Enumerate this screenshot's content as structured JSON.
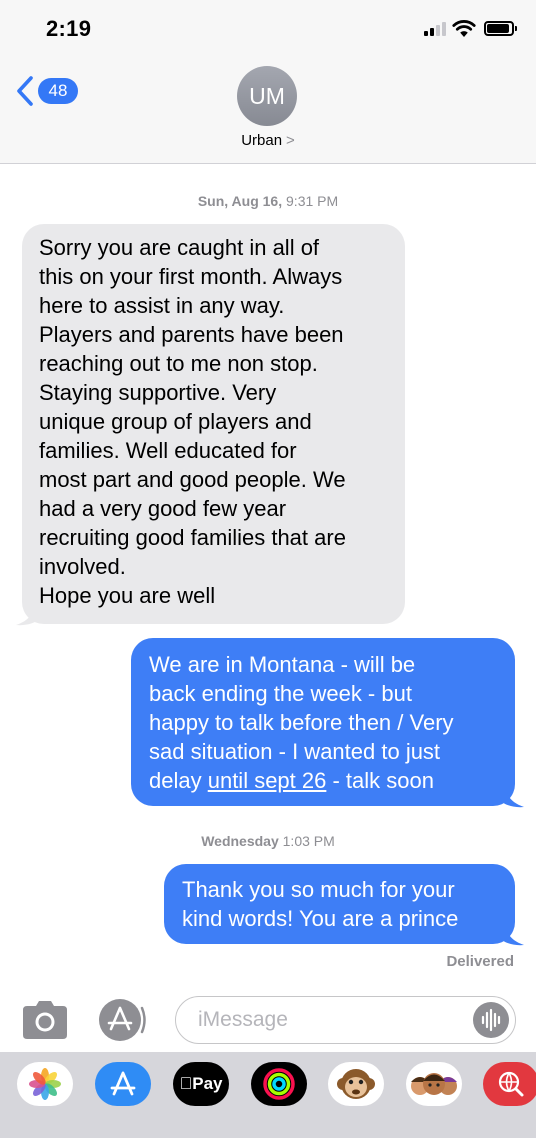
{
  "status_bar": {
    "time": "2:19",
    "signal_bars_active": 2,
    "signal_bars_total": 4,
    "battery_level": 0.9
  },
  "header": {
    "back_count": "48",
    "avatar_initials": "UM",
    "contact_name": "Urban",
    "contact_chevron": ">"
  },
  "thread": {
    "groups": [
      {
        "timestamp_day": "Sun, Aug 16,",
        "timestamp_time": "9:31 PM",
        "messages": [
          {
            "direction": "incoming",
            "lines": [
              "Sorry you are caught in all of",
              "this on your first month. Always",
              "here to assist in any way.",
              "Players and parents have been",
              "reaching out to me non stop.",
              "Staying supportive. Very",
              "unique group of players and",
              "families. Well educated for",
              "most part and good people. We",
              "had a very good few year",
              "recruiting good families that are",
              "involved.",
              "Hope you are well"
            ]
          },
          {
            "direction": "outgoing",
            "lines": [
              "We are in Montana - will be",
              "back ending the week - but",
              "happy to talk before then / Very",
              "sad situation - I wanted to just"
            ],
            "last_line_before": "delay ",
            "last_line_link": "until sept 26",
            "last_line_after": " - talk soon"
          }
        ]
      },
      {
        "timestamp_day": "Wednesday",
        "timestamp_time": "1:03 PM",
        "messages": [
          {
            "direction": "outgoing",
            "lines": [
              "Thank you so much for your",
              "kind words! You are a prince"
            ]
          }
        ]
      }
    ],
    "delivered_status": "Delivered"
  },
  "input_bar": {
    "placeholder": "iMessage",
    "icons": [
      "camera-icon",
      "app-store-icon",
      "audio-waveform-icon"
    ]
  },
  "app_drawer": {
    "apple_pay_label": "Pay",
    "apps": [
      "photos",
      "app-store",
      "apple-pay",
      "activity",
      "monkey-animoji",
      "memoji",
      "search-images"
    ]
  },
  "colors": {
    "outgoing_bubble": "#3e7ef6",
    "incoming_bubble": "#e9e9eb",
    "accent": "#3478f6",
    "secondary_text": "#8e8e93"
  }
}
